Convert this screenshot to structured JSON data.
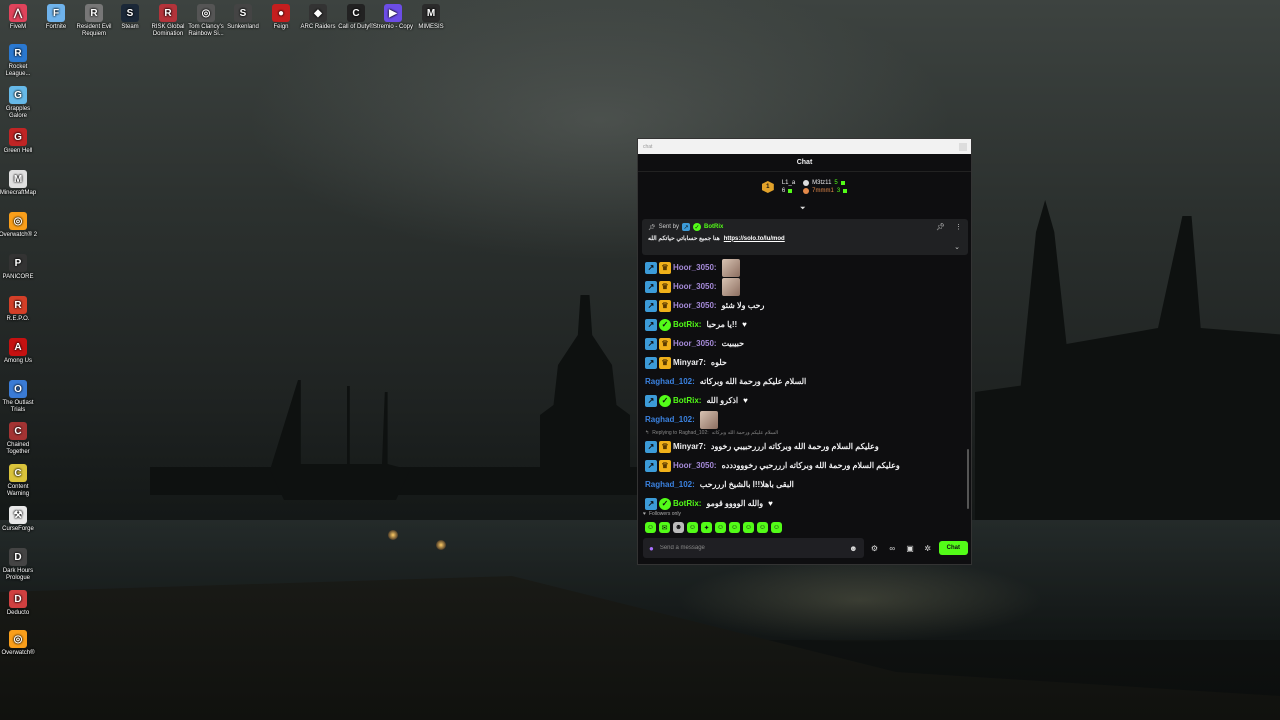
{
  "desktop": {
    "icons": [
      {
        "label": "FiveM",
        "color": "#e0435b",
        "glyph": "⋀"
      },
      {
        "label": "Fortnite",
        "color": "#6fb3ec",
        "glyph": "F"
      },
      {
        "label": "Resident Evil Requiem",
        "color": "#777777",
        "glyph": "R"
      },
      {
        "label": "Steam",
        "color": "#1b2838",
        "glyph": "S"
      },
      {
        "label": "RISK Global Domination",
        "color": "#b3333a",
        "glyph": "R"
      },
      {
        "label": "Tom Clancy's Rainbow Si...",
        "color": "#555555",
        "glyph": "◎"
      },
      {
        "label": "Sunkenland",
        "color": "#444444",
        "glyph": "S"
      },
      {
        "label": "Feign",
        "color": "#c41e1e",
        "glyph": "●"
      },
      {
        "label": "ARC Raiders",
        "color": "#333333",
        "glyph": "◆"
      },
      {
        "label": "Call of Duty®",
        "color": "#222222",
        "glyph": "C"
      },
      {
        "label": "Stremio - Copy",
        "color": "#6c4de6",
        "glyph": "▶"
      },
      {
        "label": "MIMESIS",
        "color": "#2b2b2b",
        "glyph": "M"
      },
      {
        "label": "Rocket League...",
        "color": "#2a78d0",
        "glyph": "R"
      },
      {
        "label": "Grapples Galore",
        "color": "#66b9e8",
        "glyph": "G"
      },
      {
        "label": "Green Hell",
        "color": "#c02525",
        "glyph": "G"
      },
      {
        "label": "MinecraftMap",
        "color": "#e0e0e0",
        "glyph": "M"
      },
      {
        "label": "Overwatch® 2",
        "color": "#f99e1a",
        "glyph": "◎"
      },
      {
        "label": "PANICORE",
        "color": "#333333",
        "glyph": "P"
      },
      {
        "label": "R.E.P.O.",
        "color": "#d33f28",
        "glyph": "R"
      },
      {
        "label": "Among Us",
        "color": "#c51111",
        "glyph": "A"
      },
      {
        "label": "The Outlast Trials",
        "color": "#3a7bd5",
        "glyph": "O"
      },
      {
        "label": "Chained Together",
        "color": "#a33333",
        "glyph": "C"
      },
      {
        "label": "Content Warning",
        "color": "#dac33b",
        "glyph": "C"
      },
      {
        "label": "CurseForge",
        "color": "#e8e8e8",
        "glyph": "⚒"
      },
      {
        "label": "Dark Hours Prologue",
        "color": "#444444",
        "glyph": "D"
      },
      {
        "label": "Deducto",
        "color": "#d04040",
        "glyph": "D"
      },
      {
        "label": "Overwatch®",
        "color": "#f99e1a",
        "glyph": "◎"
      }
    ]
  },
  "chat_window": {
    "window_title": "chat",
    "header": "Chat",
    "leaderboard": [
      {
        "rank": "1",
        "name": "L1_a",
        "count": "6"
      },
      {
        "name": "M3tz11",
        "count": "5"
      },
      {
        "name": "7mmm1",
        "count": "3"
      }
    ],
    "pinned": {
      "sent_by_label": "Sent by",
      "sender": "BotRix",
      "text": "هنا جميع حساباتي حياتكم الله",
      "link": "https://solo.to/lu/mod"
    },
    "messages": [
      {
        "user": "Hoor_3050:",
        "text": "",
        "emote": true
      },
      {
        "user": "Hoor_3050:",
        "text": "",
        "emote": true
      },
      {
        "user": "Hoor_3050:",
        "text": "رحب ولا شئو"
      },
      {
        "user": "BotRix:",
        "text": "يا مرحبا!!",
        "heart": true
      },
      {
        "user": "Hoor_3050:",
        "text": "حبيبيت"
      },
      {
        "user": "Minyar7:",
        "text": "حلوه"
      },
      {
        "user": "Raghad_102:",
        "text": "السلام عليكم ورحمة الله وبركاته"
      },
      {
        "user": "BotRix:",
        "text": "اذكرو الله",
        "heart": true
      },
      {
        "user": "Raghad_102:",
        "text": "",
        "emote": true
      },
      {
        "user": "Minyar7:",
        "text": "وعليكم السلام ورحمة الله وبركاته ارررحبيبي رخوود",
        "reply": "Replying to Raghad_102:",
        "reply_text": "السلام عليكم ورحمة الله وبركاته"
      },
      {
        "user": "Hoor_3050:",
        "text": "وعليكم السلام ورحمة الله وبركاته ارررحبي رخوووددده"
      },
      {
        "user": "Raghad_102:",
        "text": "البقى باهلا!!ا بالشيخ ارررحب"
      },
      {
        "user": "BotRix:",
        "text": "والله الوووو قومو",
        "heart": true
      }
    ],
    "followers_only": "Followers only",
    "input_placeholder": "Send a message",
    "send_label": "Chat"
  }
}
